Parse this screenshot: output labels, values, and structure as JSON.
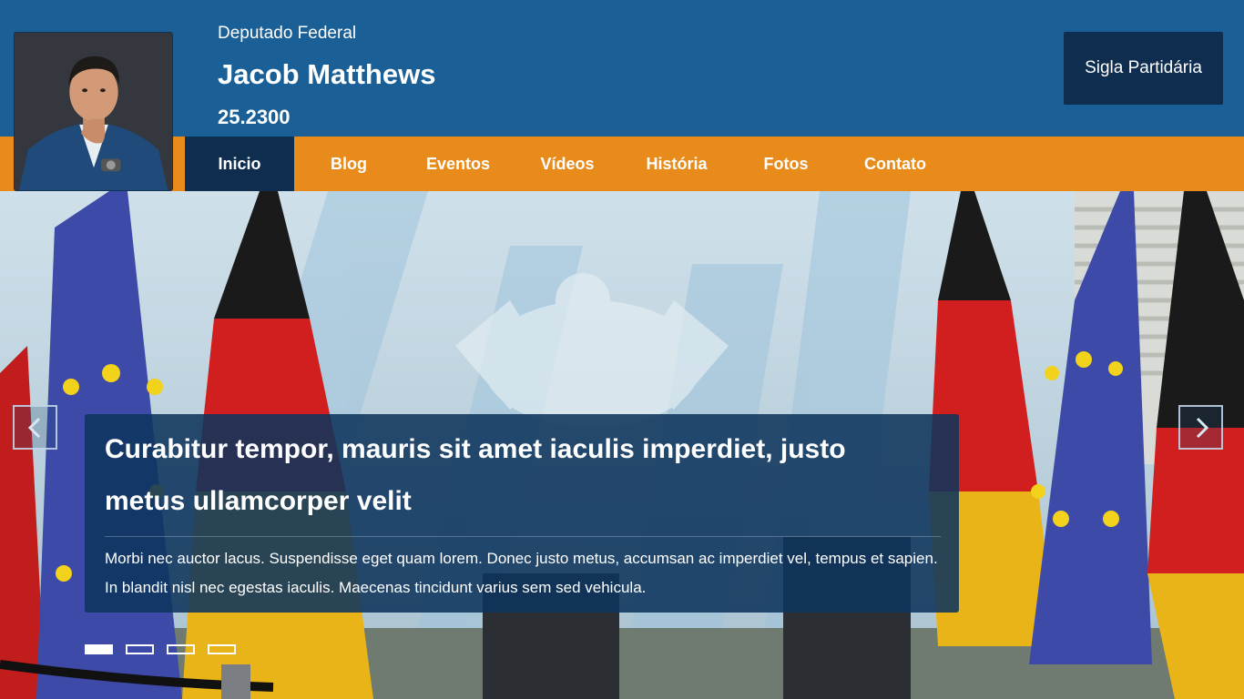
{
  "header": {
    "role": "Deputado Federal",
    "name": "Jacob Matthews",
    "number": "25.2300",
    "party_button": "Sigla Partidária"
  },
  "nav": {
    "items": [
      "Inicio",
      "Blog",
      "Eventos",
      "Vídeos",
      "História",
      "Fotos",
      "Contato"
    ],
    "active_index": 0
  },
  "slider": {
    "headline": "Curabitur tempor, mauris sit amet iaculis imperdiet, justo metus ullamcorper velit",
    "body": "Morbi nec auctor lacus. Suspendisse eget quam lorem. Donec justo metus, accumsan ac imperdiet vel, tempus et sapien. In blandit nisl nec egestas iaculis. Maecenas tincidunt varius sem sed vehicula.",
    "slide_count": 4,
    "active_slide": 1,
    "prev_icon": "chevron-left-icon",
    "next_icon": "chevron-right-icon"
  },
  "colors": {
    "header_blue": "#1a5f96",
    "nav_orange": "#e88b1a",
    "dark_navy": "#0e2d4f"
  }
}
